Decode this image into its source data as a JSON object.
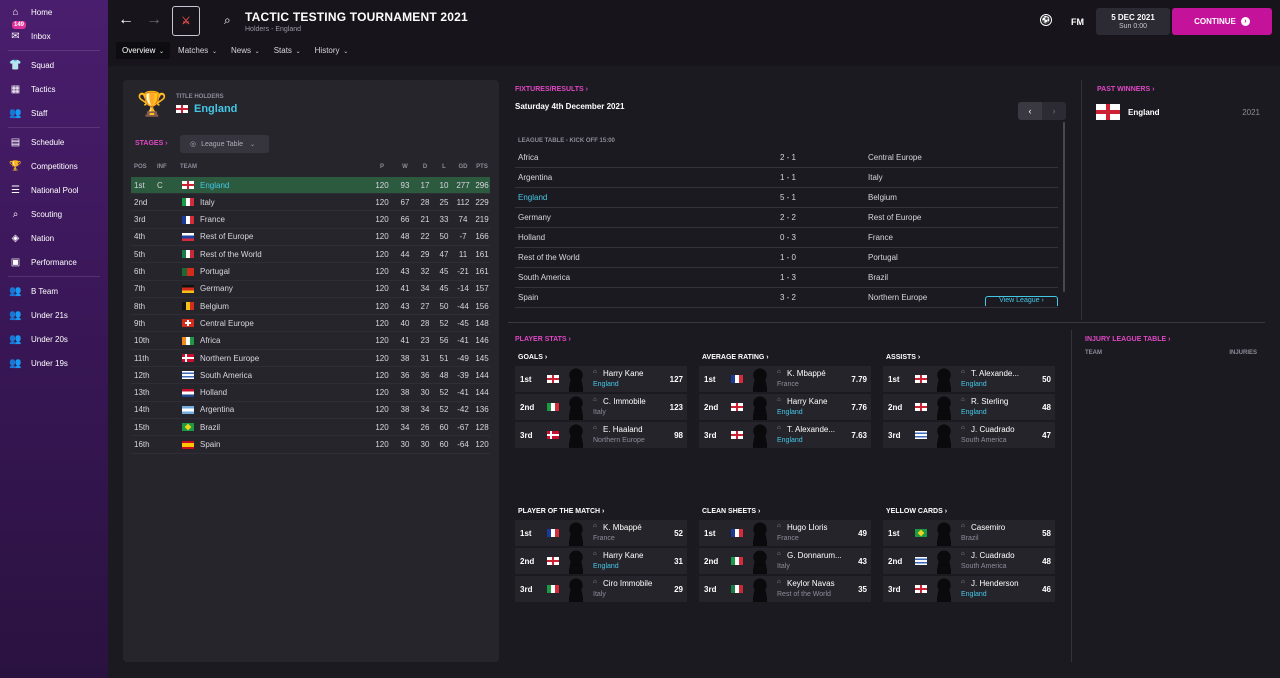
{
  "sidebar": {
    "items": [
      {
        "label": "Home",
        "icon": "home-icon",
        "glyph": "⌂"
      },
      {
        "label": "Inbox",
        "icon": "inbox-icon",
        "glyph": "✉",
        "badge": "149"
      },
      {
        "label": "Squad",
        "icon": "shirt-icon",
        "glyph": "👕"
      },
      {
        "label": "Tactics",
        "icon": "tactics-icon",
        "glyph": "▦"
      },
      {
        "label": "Staff",
        "icon": "staff-icon",
        "glyph": "👥"
      },
      {
        "label": "Schedule",
        "icon": "calendar-icon",
        "glyph": "▤"
      },
      {
        "label": "Competitions",
        "icon": "trophy-icon",
        "glyph": "🏆"
      },
      {
        "label": "National Pool",
        "icon": "list-icon",
        "glyph": "☰"
      },
      {
        "label": "Scouting",
        "icon": "magnifier-icon",
        "glyph": "⌕"
      },
      {
        "label": "Nation",
        "icon": "shield-icon",
        "glyph": "◈"
      },
      {
        "label": "Performance",
        "icon": "performance-icon",
        "glyph": "▣"
      },
      {
        "label": "B Team",
        "icon": "b-team-icon",
        "glyph": "👥"
      },
      {
        "label": "Under 21s",
        "icon": "u21-icon",
        "glyph": "👥"
      },
      {
        "label": "Under 20s",
        "icon": "u20-icon",
        "glyph": "👥"
      },
      {
        "label": "Under 19s",
        "icon": "u19-icon",
        "glyph": "👥"
      }
    ]
  },
  "header": {
    "title": "TACTIC TESTING TOURNAMENT 2021",
    "subtitle": "Holders - England",
    "tabs": [
      "Overview",
      "Matches",
      "News",
      "Stats",
      "History"
    ],
    "fm": "FM",
    "date": "5 DEC 2021",
    "time": "Sun 0:00",
    "continue": "CONTINUE"
  },
  "holders": {
    "label": "TITLE HOLDERS",
    "team": "England"
  },
  "stages": {
    "label": "STAGES",
    "select": "League Table"
  },
  "league": {
    "headers": [
      "POS",
      "INF",
      "TEAM",
      "P",
      "W",
      "D",
      "L",
      "GD",
      "PTS"
    ],
    "rows": [
      [
        "1st",
        "C",
        "England",
        "120",
        "93",
        "17",
        "10",
        "277",
        "296"
      ],
      [
        "2nd",
        "",
        "Italy",
        "120",
        "67",
        "28",
        "25",
        "112",
        "229"
      ],
      [
        "3rd",
        "",
        "France",
        "120",
        "66",
        "21",
        "33",
        "74",
        "219"
      ],
      [
        "4th",
        "",
        "Rest of Europe",
        "120",
        "48",
        "22",
        "50",
        "-7",
        "166"
      ],
      [
        "5th",
        "",
        "Rest of the World",
        "120",
        "44",
        "29",
        "47",
        "11",
        "161"
      ],
      [
        "6th",
        "",
        "Portugal",
        "120",
        "43",
        "32",
        "45",
        "-21",
        "161"
      ],
      [
        "7th",
        "",
        "Germany",
        "120",
        "41",
        "34",
        "45",
        "-14",
        "157"
      ],
      [
        "8th",
        "",
        "Belgium",
        "120",
        "43",
        "27",
        "50",
        "-44",
        "156"
      ],
      [
        "9th",
        "",
        "Central Europe",
        "120",
        "40",
        "28",
        "52",
        "-45",
        "148"
      ],
      [
        "10th",
        "",
        "Africa",
        "120",
        "41",
        "23",
        "56",
        "-41",
        "146"
      ],
      [
        "11th",
        "",
        "Northern Europe",
        "120",
        "38",
        "31",
        "51",
        "-49",
        "145"
      ],
      [
        "12th",
        "",
        "South America",
        "120",
        "36",
        "36",
        "48",
        "-39",
        "144"
      ],
      [
        "13th",
        "",
        "Holland",
        "120",
        "38",
        "30",
        "52",
        "-41",
        "144"
      ],
      [
        "14th",
        "",
        "Argentina",
        "120",
        "38",
        "34",
        "52",
        "-42",
        "136"
      ],
      [
        "15th",
        "",
        "Brazil",
        "120",
        "34",
        "26",
        "60",
        "-67",
        "128"
      ],
      [
        "16th",
        "",
        "Spain",
        "120",
        "30",
        "30",
        "60",
        "-64",
        "120"
      ]
    ]
  },
  "fixtures": {
    "label": "FIXTURES/RESULTS",
    "date": "Saturday 4th December 2021",
    "sub": "LEAGUE TABLE - KICK OFF 15:00",
    "view": "View League",
    "rows": [
      [
        "Africa",
        "2 - 1",
        "Central Europe"
      ],
      [
        "Argentina",
        "1 - 1",
        "Italy"
      ],
      [
        "England",
        "5 - 1",
        "Belgium"
      ],
      [
        "Germany",
        "2 - 2",
        "Rest of Europe"
      ],
      [
        "Holland",
        "0 - 3",
        "France"
      ],
      [
        "Rest of the World",
        "1 - 0",
        "Portugal"
      ],
      [
        "South America",
        "1 - 3",
        "Brazil"
      ],
      [
        "Spain",
        "3 - 2",
        "Northern Europe"
      ]
    ]
  },
  "past_winners": {
    "label": "PAST WINNERS",
    "team": "England",
    "year": "2021"
  },
  "player_stats": {
    "label": "PLAYER STATS"
  },
  "injury": {
    "label": "INJURY LEAGUE TABLE",
    "col1": "TEAM",
    "col2": "INJURIES"
  },
  "stat_blocks": [
    {
      "title": "GOALS",
      "rows": [
        {
          "pos": "1st",
          "name": "Harry Kane",
          "team": "England",
          "val": "127",
          "flag": "eng"
        },
        {
          "pos": "2nd",
          "name": "C. Immobile",
          "team": "Italy",
          "val": "123",
          "flag": "ita"
        },
        {
          "pos": "3rd",
          "name": "E. Haaland",
          "team": "Northern Europe",
          "val": "98",
          "flag": "neu"
        }
      ]
    },
    {
      "title": "AVERAGE RATING",
      "rows": [
        {
          "pos": "1st",
          "name": "K. Mbappé",
          "team": "France",
          "val": "7.79",
          "flag": "fra"
        },
        {
          "pos": "2nd",
          "name": "Harry Kane",
          "team": "England",
          "val": "7.76",
          "flag": "eng"
        },
        {
          "pos": "3rd",
          "name": "T. Alexande...",
          "team": "England",
          "val": "7.63",
          "flag": "eng"
        }
      ]
    },
    {
      "title": "ASSISTS",
      "rows": [
        {
          "pos": "1st",
          "name": "T. Alexande...",
          "team": "England",
          "val": "50",
          "flag": "eng"
        },
        {
          "pos": "2nd",
          "name": "R. Sterling",
          "team": "England",
          "val": "48",
          "flag": "eng"
        },
        {
          "pos": "3rd",
          "name": "J. Cuadrado",
          "team": "South America",
          "val": "47",
          "flag": "uru"
        }
      ]
    },
    {
      "title": "PLAYER OF THE MATCH",
      "rows": [
        {
          "pos": "1st",
          "name": "K. Mbappé",
          "team": "France",
          "val": "52",
          "flag": "fra"
        },
        {
          "pos": "2nd",
          "name": "Harry Kane",
          "team": "England",
          "val": "31",
          "flag": "eng"
        },
        {
          "pos": "3rd",
          "name": "Ciro Immobile",
          "team": "Italy",
          "val": "29",
          "flag": "ita"
        }
      ]
    },
    {
      "title": "CLEAN SHEETS",
      "rows": [
        {
          "pos": "1st",
          "name": "Hugo Lloris",
          "team": "France",
          "val": "49",
          "flag": "fra"
        },
        {
          "pos": "2nd",
          "name": "G. Donnarum...",
          "team": "Italy",
          "val": "43",
          "flag": "ita"
        },
        {
          "pos": "3rd",
          "name": "Keylor Navas",
          "team": "Rest of the World",
          "val": "35",
          "flag": "mex"
        }
      ]
    },
    {
      "title": "YELLOW CARDS",
      "rows": [
        {
          "pos": "1st",
          "name": "Casemiro",
          "team": "Brazil",
          "val": "58",
          "flag": "bra"
        },
        {
          "pos": "2nd",
          "name": "J. Cuadrado",
          "team": "South America",
          "val": "48",
          "flag": "uru"
        },
        {
          "pos": "3rd",
          "name": "J. Henderson",
          "team": "England",
          "val": "46",
          "flag": "eng"
        }
      ]
    }
  ],
  "colors": {
    "accent": "#c4139a",
    "highlight_row": "#2b5a3f",
    "link": "#44c7e6",
    "pink": "#e048c4"
  }
}
